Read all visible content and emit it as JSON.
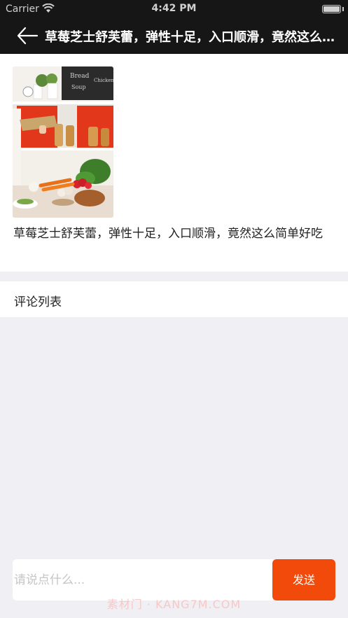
{
  "status_bar": {
    "carrier": "Carrier",
    "time": "4:42 PM",
    "battery_level": 1.0
  },
  "nav": {
    "title": "草莓芝士舒芙蕾，弹性十足，入口顺滑，竟然这么简单好吃",
    "back_icon": "arrow-left-icon"
  },
  "article": {
    "caption": "草莓芝士舒芙蕾，弹性十足，入口顺滑，竟然这么简单好吃"
  },
  "comments": {
    "header": "评论列表"
  },
  "composer": {
    "placeholder": "请说点什么...",
    "value": "",
    "send_label": "发送"
  },
  "watermark": "素材门 · KANG7M.COM",
  "colors": {
    "nav_background": "#161616",
    "accent": "#f24a0a",
    "page_background": "#efeff4"
  }
}
